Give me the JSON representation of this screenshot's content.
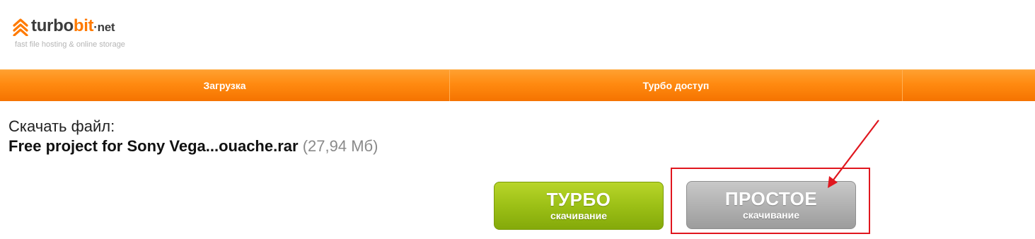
{
  "header": {
    "logo": {
      "part1": "turbo",
      "part2": "bit",
      "part3": "·net",
      "tagline": "fast file hosting & online storage"
    }
  },
  "nav": {
    "items": [
      {
        "label": "Загрузка"
      },
      {
        "label": "Турбо доступ"
      },
      {
        "label": ""
      }
    ]
  },
  "download": {
    "heading": "Скачать файл:",
    "filename": "Free project for Sony Vega...ouache.rar",
    "filesize": "(27,94 Мб)"
  },
  "buttons": {
    "turbo": {
      "title": "ТУРБО",
      "subtitle": "скачивание"
    },
    "simple": {
      "title": "ПРОСТОЕ",
      "subtitle": "скачивание"
    }
  },
  "colors": {
    "brand_orange": "#ff8a10",
    "turbo_green": "#9cc016",
    "simple_gray": "#b2b2b2",
    "annotation_red": "#e0161e"
  },
  "icons": {
    "logo_mark": "double-chevron-up-icon",
    "annotation": "red-arrow-icon"
  }
}
